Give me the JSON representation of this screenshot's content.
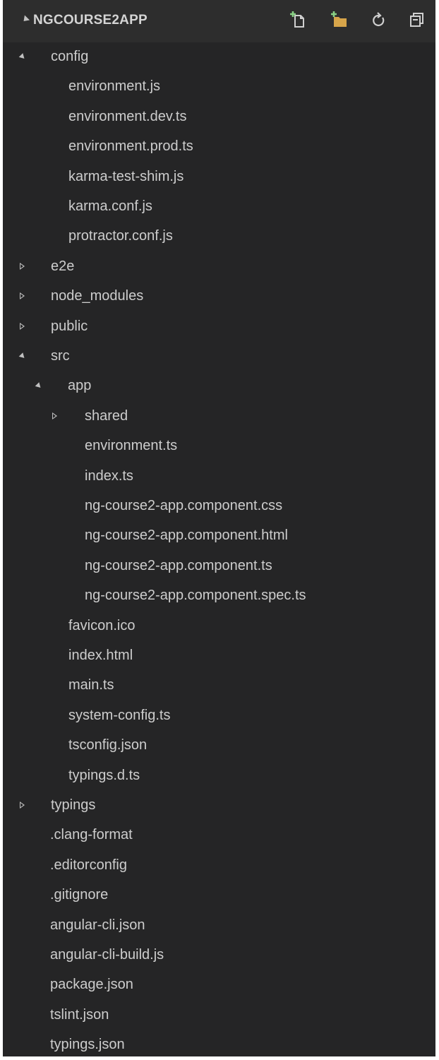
{
  "explorer": {
    "title": "NGCOURSE2APP",
    "actions": [
      {
        "name": "new-file-icon"
      },
      {
        "name": "new-folder-icon"
      },
      {
        "name": "refresh-icon"
      },
      {
        "name": "collapse-all-icon"
      }
    ],
    "colors": {
      "background": "#252526",
      "header": "#2d2d2d",
      "text": "#cccccc",
      "folder_accent": "#d7a54a"
    }
  },
  "tree": [
    {
      "label": "config",
      "depth": 0,
      "kind": "folder",
      "expanded": true
    },
    {
      "label": "environment.js",
      "depth": 1,
      "kind": "file"
    },
    {
      "label": "environment.dev.ts",
      "depth": 1,
      "kind": "file"
    },
    {
      "label": "environment.prod.ts",
      "depth": 1,
      "kind": "file"
    },
    {
      "label": "karma-test-shim.js",
      "depth": 1,
      "kind": "file"
    },
    {
      "label": "karma.conf.js",
      "depth": 1,
      "kind": "file"
    },
    {
      "label": "protractor.conf.js",
      "depth": 1,
      "kind": "file"
    },
    {
      "label": "e2e",
      "depth": 0,
      "kind": "folder",
      "expanded": false
    },
    {
      "label": "node_modules",
      "depth": 0,
      "kind": "folder",
      "expanded": false
    },
    {
      "label": "public",
      "depth": 0,
      "kind": "folder",
      "expanded": false
    },
    {
      "label": "src",
      "depth": 0,
      "kind": "folder",
      "expanded": true
    },
    {
      "label": "app",
      "depth": 1,
      "kind": "folder",
      "expanded": true
    },
    {
      "label": "shared",
      "depth": 2,
      "kind": "folder",
      "expanded": false
    },
    {
      "label": "environment.ts",
      "depth": 2,
      "kind": "file"
    },
    {
      "label": "index.ts",
      "depth": 2,
      "kind": "file"
    },
    {
      "label": "ng-course2-app.component.css",
      "depth": 2,
      "kind": "file"
    },
    {
      "label": "ng-course2-app.component.html",
      "depth": 2,
      "kind": "file"
    },
    {
      "label": "ng-course2-app.component.ts",
      "depth": 2,
      "kind": "file"
    },
    {
      "label": "ng-course2-app.component.spec.ts",
      "depth": 2,
      "kind": "file"
    },
    {
      "label": "favicon.ico",
      "depth": 1,
      "kind": "file"
    },
    {
      "label": "index.html",
      "depth": 1,
      "kind": "file"
    },
    {
      "label": "main.ts",
      "depth": 1,
      "kind": "file"
    },
    {
      "label": "system-config.ts",
      "depth": 1,
      "kind": "file"
    },
    {
      "label": "tsconfig.json",
      "depth": 1,
      "kind": "file"
    },
    {
      "label": "typings.d.ts",
      "depth": 1,
      "kind": "file"
    },
    {
      "label": "typings",
      "depth": 0,
      "kind": "folder",
      "expanded": false
    },
    {
      "label": ".clang-format",
      "depth": 0,
      "kind": "file"
    },
    {
      "label": ".editorconfig",
      "depth": 0,
      "kind": "file"
    },
    {
      "label": ".gitignore",
      "depth": 0,
      "kind": "file"
    },
    {
      "label": "angular-cli.json",
      "depth": 0,
      "kind": "file"
    },
    {
      "label": "angular-cli-build.js",
      "depth": 0,
      "kind": "file"
    },
    {
      "label": "package.json",
      "depth": 0,
      "kind": "file"
    },
    {
      "label": "tslint.json",
      "depth": 0,
      "kind": "file"
    },
    {
      "label": "typings.json",
      "depth": 0,
      "kind": "file"
    }
  ]
}
